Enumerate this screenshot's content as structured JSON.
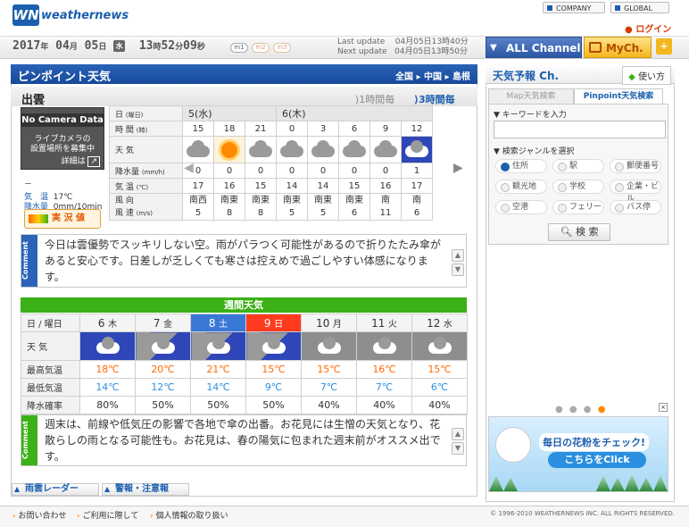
{
  "header": {
    "logo_mark": "WN",
    "logo_text": "weathernews",
    "company": "COMPANY",
    "global": "GLOBAL",
    "login": "ログイン"
  },
  "topbar": {
    "year": "2017",
    "year_u": "年",
    "month": "04",
    "month_u": "月",
    "day": "05",
    "day_u": "日",
    "weekday": "水",
    "hour": "13",
    "hour_u": "時",
    "min": "52",
    "min_u": "分",
    "sec": "09",
    "sec_u": "秒",
    "pills": [
      "m1",
      "m2",
      "m3"
    ],
    "last_update_label": "Last update",
    "last_update": "04月05日13時40分",
    "next_update_label": "Next update",
    "next_update": "04月05日13時50分",
    "all_channel": "ALL Channel",
    "mych": "MyCh.",
    "plus": "+"
  },
  "main": {
    "title": "ピンポイント天気",
    "region": [
      "全国",
      "中国",
      "島根"
    ],
    "city": "出雲",
    "hourly_btn": "1時間毎",
    "threehour_btn": "3時間毎",
    "camera": {
      "line1": "No Camera Data",
      "line2": "ライブカメラの",
      "line3": "設置場所を募集中",
      "detail": "詳細は"
    },
    "obs": {
      "dash": "－",
      "temp_label": "気　温",
      "temp": "17℃",
      "rain_label": "降水量",
      "rain": "0mm/10min"
    },
    "jikkan": "実 況 値",
    "hourly": {
      "labels": {
        "day": "日",
        "day_u": "(曜日)",
        "time": "時 間",
        "time_u": "(時)",
        "weather": "天 気",
        "rain": "降水量",
        "rain_u": "(mm/h)",
        "temp": "気 温",
        "temp_u": "(℃)",
        "wind_dir": "風 向",
        "wind_spd": "風 速",
        "wind_u": "(m/s)"
      },
      "day1": "5(水)",
      "day2": "6(木)",
      "hours": [
        "15",
        "18",
        "21",
        "0",
        "3",
        "6",
        "9",
        "12"
      ],
      "weather": [
        "cloudy",
        "sunny",
        "cloudy",
        "cloudy",
        "cloudy",
        "cloudy",
        "cloudy",
        "rain"
      ],
      "rain": [
        "0",
        "0",
        "0",
        "0",
        "0",
        "0",
        "0",
        "1"
      ],
      "temp": [
        "17",
        "16",
        "15",
        "14",
        "14",
        "15",
        "16",
        "17"
      ],
      "wind_dir": [
        "南西",
        "南東",
        "南東",
        "南東",
        "南東",
        "南東",
        "南",
        "南"
      ],
      "wind_spd": [
        "5",
        "8",
        "8",
        "5",
        "5",
        "6",
        "11",
        "6"
      ]
    },
    "comment1_tag": "Comment",
    "comment1": "今日は雲優勢でスッキリしない空。雨がパラつく可能性があるので折りたたみ傘があると安心です。日差しが乏しくても寒さは控えめで過ごしやすい体感になります。",
    "weekly": {
      "title": "週間天気",
      "labels": {
        "day": "日 / 曜日",
        "weather": "天 気",
        "hi": "最高気温",
        "lo": "最低気温",
        "pop": "降水確率"
      },
      "days": [
        {
          "d": "6",
          "w": "木"
        },
        {
          "d": "7",
          "w": "金"
        },
        {
          "d": "8",
          "w": "土"
        },
        {
          "d": "9",
          "w": "日"
        },
        {
          "d": "10",
          "w": "月"
        },
        {
          "d": "11",
          "w": "火"
        },
        {
          "d": "12",
          "w": "水"
        }
      ],
      "weather": [
        "rain-cloudy",
        "cloudy-rain",
        "cloudy-rain",
        "cloudy-rain",
        "cloudy",
        "cloudy",
        "cloudy"
      ],
      "hi": [
        "18℃",
        "20℃",
        "21℃",
        "15℃",
        "15℃",
        "16℃",
        "15℃"
      ],
      "lo": [
        "14℃",
        "12℃",
        "14℃",
        "9℃",
        "7℃",
        "7℃",
        "6℃"
      ],
      "pop": [
        "80%",
        "50%",
        "50%",
        "50%",
        "40%",
        "40%",
        "40%"
      ]
    },
    "comment2_tag": "Comment",
    "comment2": "週末は、前線や低気圧の影響で各地で傘の出番。お花見には生憎の天気となり、花散らしの雨となる可能性も。お花見は、春の陽気に包まれた週末前がオススメ出です。",
    "bottom_btns": [
      "雨雲レーダー",
      "警報・注意報"
    ]
  },
  "sidebar": {
    "title": "天気予報 Ch.",
    "beginner": "使い方",
    "tab_map": "Map天気検索",
    "tab_pin": "Pinpoint天気検索",
    "kw_label": "キーワードを入力",
    "genre_label": "検索ジャンルを選択",
    "genres": [
      "住所",
      "駅",
      "郵便番号",
      "観光地",
      "学校",
      "企業・ビル",
      "空港",
      "フェリー",
      "バス停"
    ],
    "search_btn": "検 索",
    "banner_line1": "毎日の花粉をチェック!",
    "banner_line2": "こちらをClick"
  },
  "footer": {
    "links": [
      "お問い合わせ",
      "ご利用に際して",
      "個人情報の取り扱い"
    ],
    "copyright": "© 1996-2010 WEATHERNEWS INC. ALL RIGHTS RESERVED."
  }
}
